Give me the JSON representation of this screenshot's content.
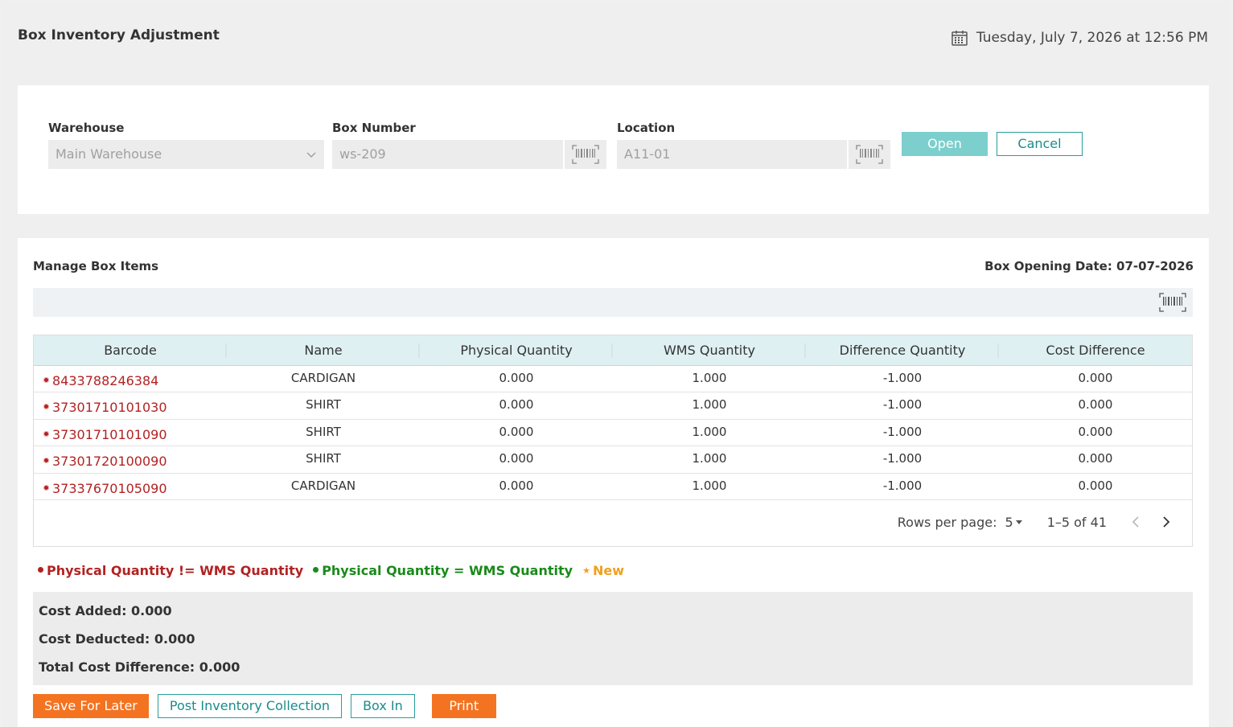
{
  "header": {
    "title": "Box Inventory Adjustment",
    "datetime": "Tuesday, July 7, 2026 at 12:56 PM"
  },
  "form": {
    "warehouse_label": "Warehouse",
    "warehouse_value": "Main Warehouse",
    "box_number_label": "Box Number",
    "box_number_value": "ws-209",
    "location_label": "Location",
    "location_value": "A11-01",
    "open_label": "Open",
    "cancel_label": "Cancel"
  },
  "manage": {
    "title": "Manage Box Items",
    "opening_date": "Box Opening Date: 07-07-2026"
  },
  "table": {
    "columns": [
      "Barcode",
      "Name",
      "Physical Quantity",
      "WMS Quantity",
      "Difference Quantity",
      "Cost Difference"
    ],
    "rows": [
      [
        "8433788246384",
        "CARDIGAN",
        "0.000",
        "1.000",
        "-1.000",
        "0.000"
      ],
      [
        "37301710101030",
        "SHIRT",
        "0.000",
        "1.000",
        "-1.000",
        "0.000"
      ],
      [
        "37301710101090",
        "SHIRT",
        "0.000",
        "1.000",
        "-1.000",
        "0.000"
      ],
      [
        "37301720100090",
        "SHIRT",
        "0.000",
        "1.000",
        "-1.000",
        "0.000"
      ],
      [
        "37337670105090",
        "CARDIGAN",
        "0.000",
        "1.000",
        "-1.000",
        "0.000"
      ]
    ]
  },
  "pager": {
    "rows_per_page_label": "Rows per page:",
    "rows_per_page_value": "5",
    "range": "1–5 of 41"
  },
  "legend": {
    "mismatch": "Physical Quantity != WMS Quantity",
    "match": "Physical Quantity = WMS Quantity",
    "new": "New"
  },
  "summary": {
    "cost_added": "Cost Added: 0.000",
    "cost_deducted": "Cost Deducted: 0.000",
    "total_cost_difference": "Total Cost Difference: 0.000"
  },
  "actions": {
    "save_for_later": "Save For Later",
    "post_inventory_collection": "Post Inventory Collection",
    "box_in": "Box In",
    "print": "Print"
  },
  "colors": {
    "accent": "#7ccfcc",
    "teal": "#1a8c8a",
    "orange": "#f47321",
    "mismatch": "#b22222",
    "match": "#1a8a1a",
    "new": "#f0a020"
  },
  "icons": [
    "calendar-icon",
    "chevron-down-icon",
    "barcode-icon",
    "chevron-left-icon",
    "chevron-right-icon"
  ]
}
